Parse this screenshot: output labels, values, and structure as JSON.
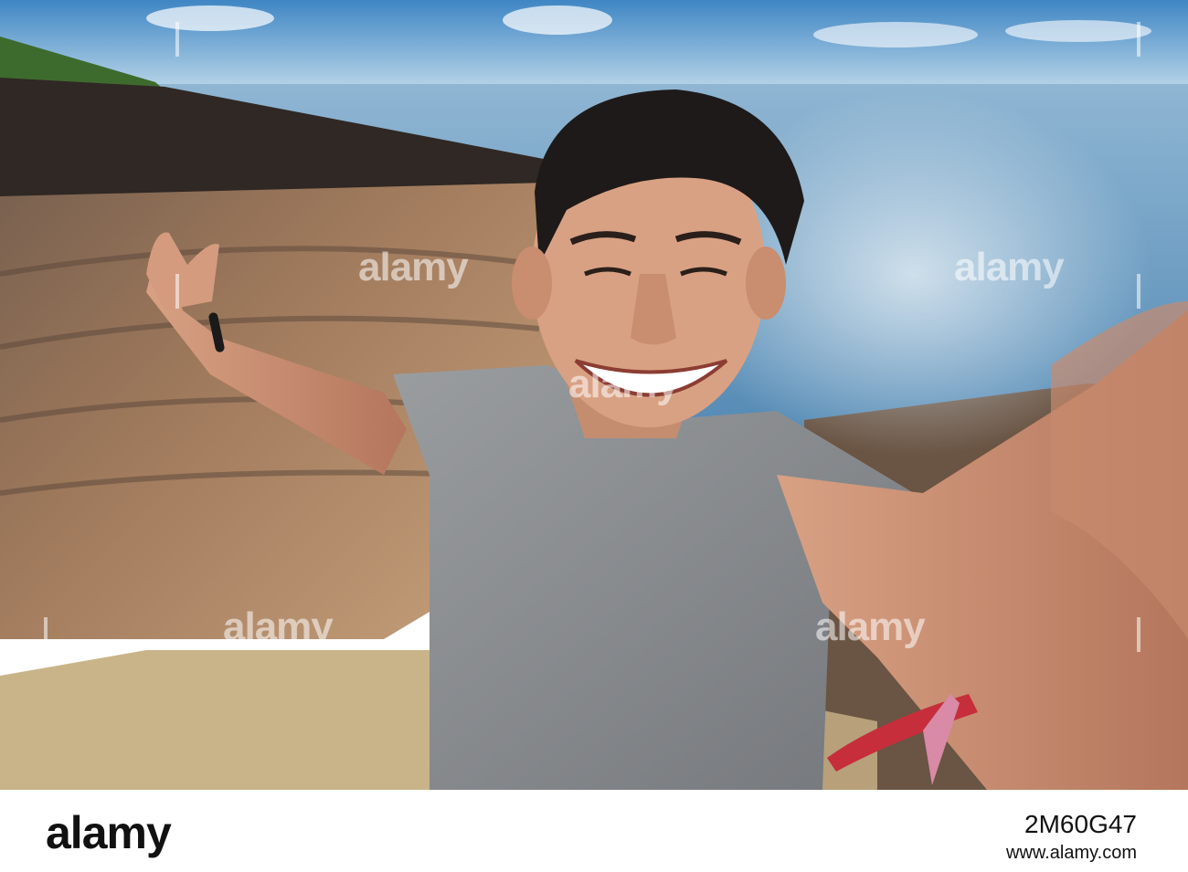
{
  "watermark": {
    "text": "alamy"
  },
  "footer": {
    "brand": "alamy",
    "image_id": "2M60G47",
    "url": "www.alamy.com"
  },
  "colors": {
    "sky": "#7fb0d6",
    "sea": "#6f9fc4",
    "crater_rock": "#8a6a52",
    "shirt": "#8c8f92",
    "skin": "#d9a183",
    "hair": "#1e1a1a"
  }
}
